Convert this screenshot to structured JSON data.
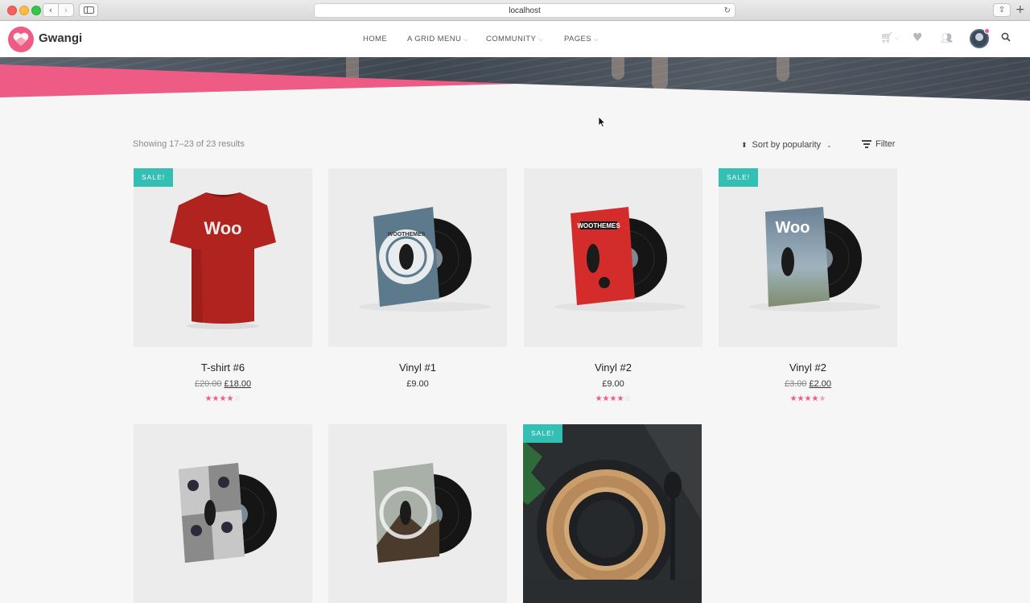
{
  "browser": {
    "url": "localhost"
  },
  "site": {
    "logo_text": "Gwangi",
    "menu": [
      {
        "label": "HOME",
        "has_dropdown": false
      },
      {
        "label": "A GRID MENU",
        "has_dropdown": true
      },
      {
        "label": "COMMUNITY",
        "has_dropdown": true
      },
      {
        "label": "PAGES",
        "has_dropdown": true
      }
    ],
    "header_icons": [
      "cart-icon",
      "heart-icon",
      "groups-icon",
      "avatar",
      "search-icon"
    ],
    "accent_color": "#ee5b84",
    "sale_color": "#33bfb3"
  },
  "shop": {
    "result_count": "Showing 17–23 of 23 results",
    "sort_label": "Sort by popularity",
    "filter_label": "Filter",
    "sale_badge": "SALE!",
    "products": [
      {
        "name": "T-shirt #6",
        "price_old": "£20.00",
        "price": "£18.00",
        "on_sale": true,
        "rating_out_of_5": 4,
        "image": "red-woo-tshirt"
      },
      {
        "name": "Vinyl #1",
        "price_old": "",
        "price": "£9.00",
        "on_sale": false,
        "rating_out_of_5": 0,
        "image": "blue-woothemes-vinyl"
      },
      {
        "name": "Vinyl #2",
        "price_old": "",
        "price": "£9.00",
        "on_sale": false,
        "rating_out_of_5": 4,
        "image": "red-woothemes-vinyl"
      },
      {
        "name": "Vinyl #2",
        "price_old": "£3.00",
        "price": "£2.00",
        "on_sale": true,
        "rating_out_of_5": 4.5,
        "image": "sky-woo-vinyl"
      },
      {
        "name": "",
        "price_old": "",
        "price": "",
        "on_sale": false,
        "image": "ninja-grid-vinyl"
      },
      {
        "name": "",
        "price_old": "",
        "price": "",
        "on_sale": false,
        "image": "mountain-woothemes-vinyl"
      },
      {
        "name": "",
        "price_old": "",
        "price": "",
        "on_sale": true,
        "image": "wooden-plate"
      }
    ]
  }
}
